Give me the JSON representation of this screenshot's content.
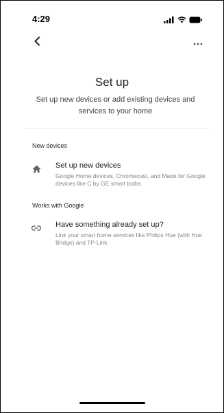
{
  "status_bar": {
    "time": "4:29"
  },
  "nav": {
    "back_icon": "chevron-left-icon",
    "more_icon": "more-horizontal-icon"
  },
  "header": {
    "title": "Set up",
    "subtitle": "Set up new devices or add existing devices and services to your home"
  },
  "sections": [
    {
      "header": "New devices",
      "items": [
        {
          "icon": "home-icon",
          "title": "Set up new devices",
          "description": "Google Home devices, Chromecast, and Made for Google devices like C by GE smart bulbs"
        }
      ]
    },
    {
      "header": "Works with Google",
      "items": [
        {
          "icon": "link-icon",
          "title": "Have something already set up?",
          "description": "Link your smart home services like Philips Hue (with Hue Bridge) and TP-Link"
        }
      ]
    }
  ],
  "colors": {
    "text_primary": "#202124",
    "text_secondary": "#80868b",
    "icon": "#5f6368",
    "divider": "#e8eaed"
  }
}
